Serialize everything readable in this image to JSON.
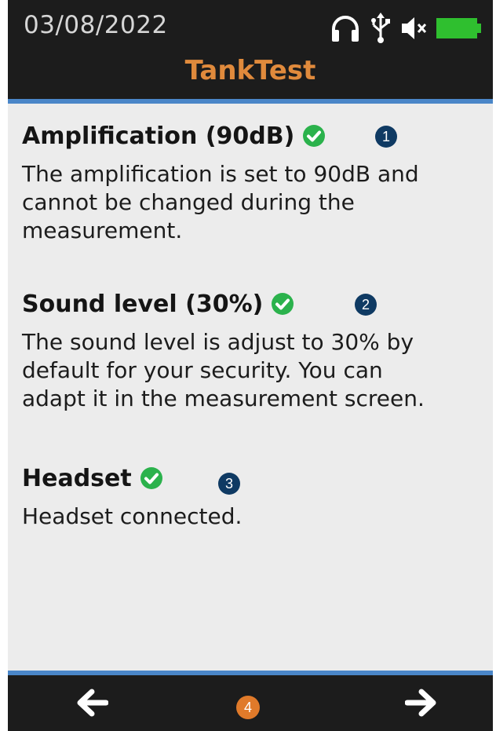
{
  "status_bar": {
    "date": "03/08/2022",
    "icons": [
      "headphones-icon",
      "usb-icon",
      "speaker-muted-icon",
      "battery-icon"
    ],
    "battery_color": "#2fbf2f"
  },
  "app": {
    "title": "TankTest",
    "title_color": "#e08a3c"
  },
  "sections": [
    {
      "title": "Amplification (90dB)",
      "status": "ok",
      "callout": "1",
      "description": "The amplification is set to 90dB and\ncannot be changed during the\nmeasurement."
    },
    {
      "title": "Sound level (30%)",
      "status": "ok",
      "callout": "2",
      "description": "The sound level is adjust to 30% by\ndefault for your security. You can\nadapt it in the measurement screen."
    },
    {
      "title": "Headset",
      "status": "ok",
      "callout": "3",
      "description": "Headset connected."
    }
  ],
  "nav": {
    "back_icon": "arrow-left-icon",
    "next_icon": "arrow-right-icon",
    "callout": "4"
  },
  "colors": {
    "accent": "#4a86c8",
    "check": "#2bb24c",
    "callout_blue": "#0f3a63",
    "callout_orange": "#e07a2a"
  }
}
